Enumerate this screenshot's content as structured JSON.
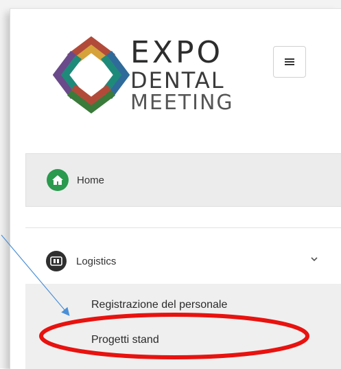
{
  "logo": {
    "line1": "EXPO",
    "line2": "DENTAL",
    "line3": "MEETING",
    "colors": [
      "#1e8a7a",
      "#b24a3a",
      "#d6a23a",
      "#6a4a8a",
      "#2f6b9a"
    ]
  },
  "header": {
    "menu_icon": "hamburger-icon"
  },
  "nav": {
    "home": {
      "label": "Home",
      "icon": "home-icon",
      "icon_color": "#2a9a4e"
    },
    "logistics": {
      "label": "Logistics",
      "icon": "logistics-icon",
      "expanded_icon": "chevron-down-icon",
      "children": [
        {
          "label": "Registrazione del personale"
        },
        {
          "label": "Progetti stand"
        }
      ]
    }
  },
  "annotations": {
    "highlight_color": "#e8120f",
    "arrow_color": "#4a90d9"
  }
}
